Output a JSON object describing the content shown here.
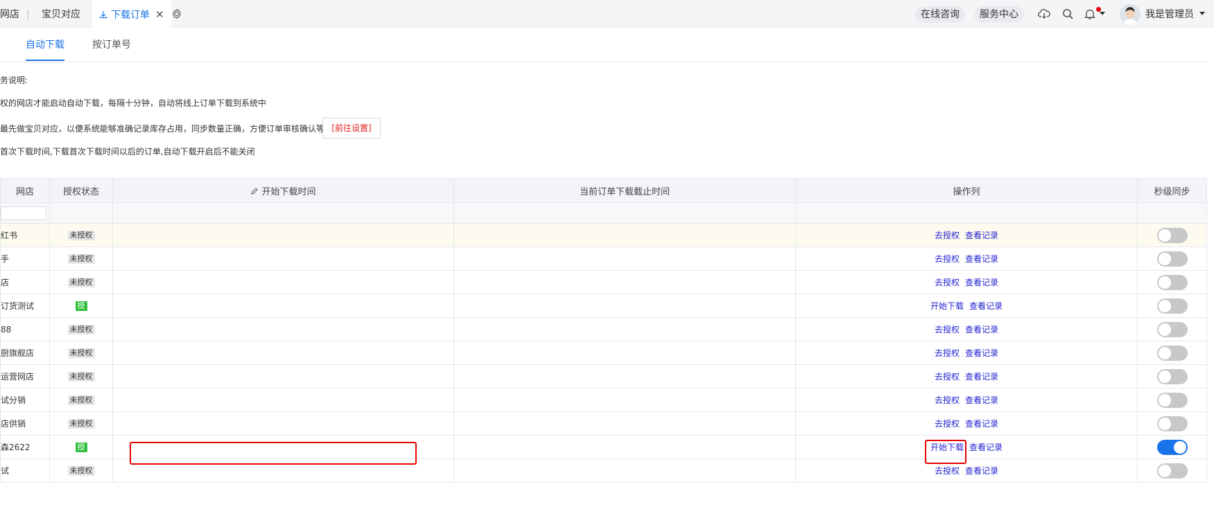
{
  "topbar": {
    "tabs": [
      "网店",
      "宝贝对应"
    ],
    "active_tab": "下载订单",
    "close_symbol": "✕",
    "online_consult": "在线咨询",
    "service_center": "服务中心",
    "username": "我是管理员"
  },
  "subtabs": [
    "自动下载",
    "按订单号"
  ],
  "notes": {
    "heading": "务说明:",
    "line1": "权的网店才能启动自动下载，每隔十分钟，自动将线上订单下载到系统中",
    "line2": "最先做宝贝对应，以便系统能够准确记录库存占用，同步数量正确，方便订单审核确认等",
    "goto_button": "[前往设置]",
    "line3": "首次下载时间,下载首次下载时间以后的订单,自动下载开启后不能关闭"
  },
  "table": {
    "columns": {
      "shop": "网店",
      "auth": "授权状态",
      "start": "开始下载时间",
      "deadline": "当前订单下载截止时间",
      "ops": "操作列",
      "sync": "秒级同步"
    },
    "filter_placeholder": "",
    "link_deauth": "去授权",
    "link_start": "开始下载",
    "link_records": "查看记录",
    "rows": [
      {
        "shop": "红书",
        "auth": "未授权",
        "authorized": false,
        "sync": false,
        "highlight": true
      },
      {
        "shop": "手",
        "auth": "未授权",
        "authorized": false,
        "sync": false
      },
      {
        "shop": "店",
        "auth": "未授权",
        "authorized": false,
        "sync": false
      },
      {
        "shop": "订货测试",
        "auth": "授",
        "authorized": true,
        "sync": false
      },
      {
        "shop": "88",
        "auth": "未授权",
        "authorized": false,
        "sync": false
      },
      {
        "shop": "厨旗舰店",
        "auth": "未授权",
        "authorized": false,
        "sync": false
      },
      {
        "shop": "运营网店",
        "auth": "未授权",
        "authorized": false,
        "sync": false
      },
      {
        "shop": "试分销",
        "auth": "未授权",
        "authorized": false,
        "sync": false
      },
      {
        "shop": "店供销",
        "auth": "未授权",
        "authorized": false,
        "sync": false
      },
      {
        "shop": "森2622",
        "auth": "授",
        "authorized": true,
        "sync": true
      },
      {
        "shop": "试",
        "auth": "未授权",
        "authorized": false,
        "sync": false
      }
    ]
  },
  "colors": {
    "accent": "#1a73e8",
    "link": "#1f1fd0",
    "annotation_red": "#e60000",
    "authorized_green": "#2fbf3b"
  }
}
